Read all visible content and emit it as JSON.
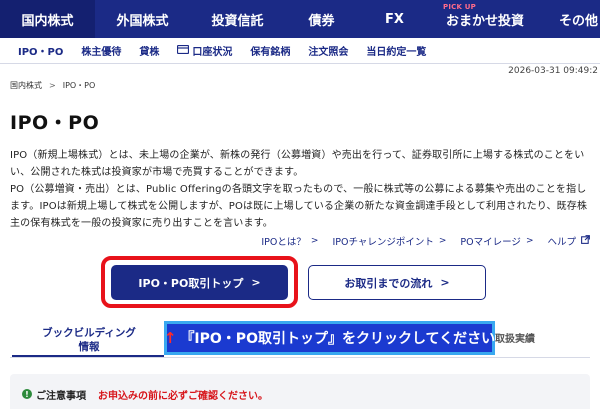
{
  "top_nav": {
    "items": [
      {
        "label": "国内株式",
        "active": true
      },
      {
        "label": "外国株式"
      },
      {
        "label": "投資信託"
      },
      {
        "label": "債券"
      },
      {
        "label": "FX"
      },
      {
        "label": "おまかせ投資",
        "badge": "PICK UP"
      },
      {
        "label": "その他"
      }
    ]
  },
  "sub_nav": {
    "items": [
      {
        "label": "IPO・PO"
      },
      {
        "label": "株主優待"
      },
      {
        "label": "貸株"
      },
      {
        "label": "口座状況",
        "icon": "account-card-icon"
      },
      {
        "label": "保有銘柄"
      },
      {
        "label": "注文照会"
      },
      {
        "label": "当日約定一覧"
      }
    ]
  },
  "timestamp": "2026-03-31 09:49:2",
  "breadcrumb": {
    "items": [
      "国内株式",
      "IPO・PO"
    ],
    "separator": ">"
  },
  "page_title": "IPO・PO",
  "description": {
    "p1": "IPO（新規上場株式）とは、未上場の企業が、新株の発行（公募増資）や売出を行って、証券取引所に上場する株式のことをいい、公開された株式は投資家が市場で売買することができます。",
    "p2": "PO（公募増資・売出）とは、Public Offeringの各頭文字を取ったもので、一般に株式等の公募による募集や売出のことを指します。IPOは新規上場して株式を公開しますが、POは既に上場している企業の新たな資金調達手段として利用されたり、既存株主の保有株式を一般の投資家に売り出すことを言います。"
  },
  "links": [
    {
      "label": "IPOとは？",
      "icon": ">"
    },
    {
      "label": "IPOチャレンジポイント",
      "icon": ">"
    },
    {
      "label": "POマイレージ",
      "icon": ">"
    },
    {
      "label": "ヘルプ",
      "icon": "external-link-icon"
    }
  ],
  "buttons": {
    "primary": {
      "label": "IPO・PO取引トップ",
      "arrow": ">"
    },
    "secondary": {
      "label": "お取引までの流れ",
      "arrow": ">"
    }
  },
  "tabs": {
    "build": {
      "line1": "ブックビルディング",
      "line2": "情報"
    },
    "record": {
      "label": "取扱実績"
    }
  },
  "callout": {
    "arrow": "↑",
    "text": "『IPO・PO取引トップ』をクリックしてください"
  },
  "notice": {
    "icon": "!",
    "title": "ご注意事項",
    "text": "お申込みの前に必ずご確認ください。"
  },
  "colors": {
    "brand": "#1b2a86",
    "alert": "#e8121a",
    "callout_bg": "#1b3ad0",
    "callout_border": "#39a8f0"
  }
}
